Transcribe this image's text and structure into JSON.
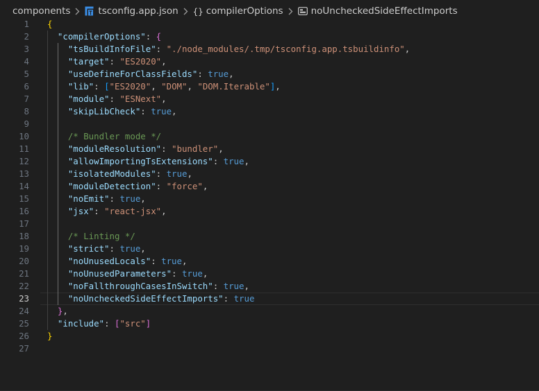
{
  "breadcrumb": {
    "folder": "components",
    "file": "tsconfig.app.json",
    "object_icon": "{}",
    "object": "compilerOptions",
    "property": "noUncheckedSideEffectImports"
  },
  "icons": {
    "file_icon": "typescript-config-file-icon",
    "object_icon": "json-object-icon",
    "property_icon": "json-property-icon",
    "separator_icon": "chevron-right-icon"
  },
  "colors": {
    "background": "#1f1f1f",
    "key": "#9cdcfe",
    "string": "#ce9178",
    "boolean": "#569cd6",
    "comment": "#6a9955",
    "bracket_level1": "#ffd700",
    "bracket_level2": "#da70d6",
    "bracket_level3": "#179fff"
  },
  "editor": {
    "current_line": 23,
    "lines": [
      {
        "n": "1",
        "t": [
          [
            "{",
            "b1"
          ]
        ]
      },
      {
        "n": "2",
        "t": [
          [
            "  "
          ],
          [
            "\"compilerOptions\"",
            "key"
          ],
          [
            ": ",
            "pun"
          ],
          [
            "{",
            "b2"
          ]
        ]
      },
      {
        "n": "3",
        "t": [
          [
            "    "
          ],
          [
            "\"tsBuildInfoFile\"",
            "key"
          ],
          [
            ": ",
            "pun"
          ],
          [
            "\"./node_modules/.tmp/tsconfig.app.tsbuildinfo\"",
            "str"
          ],
          [
            ",",
            "pun"
          ]
        ]
      },
      {
        "n": "4",
        "t": [
          [
            "    "
          ],
          [
            "\"target\"",
            "key"
          ],
          [
            ": ",
            "pun"
          ],
          [
            "\"ES2020\"",
            "str"
          ],
          [
            ",",
            "pun"
          ]
        ]
      },
      {
        "n": "5",
        "t": [
          [
            "    "
          ],
          [
            "\"useDefineForClassFields\"",
            "key"
          ],
          [
            ": ",
            "pun"
          ],
          [
            "true",
            "bool"
          ],
          [
            ",",
            "pun"
          ]
        ]
      },
      {
        "n": "6",
        "t": [
          [
            "    "
          ],
          [
            "\"lib\"",
            "key"
          ],
          [
            ": ",
            "pun"
          ],
          [
            "[",
            "b3"
          ],
          [
            "\"ES2020\"",
            "str"
          ],
          [
            ", ",
            "pun"
          ],
          [
            "\"DOM\"",
            "str"
          ],
          [
            ", ",
            "pun"
          ],
          [
            "\"DOM.Iterable\"",
            "str"
          ],
          [
            "]",
            "b3"
          ],
          [
            ",",
            "pun"
          ]
        ]
      },
      {
        "n": "7",
        "t": [
          [
            "    "
          ],
          [
            "\"module\"",
            "key"
          ],
          [
            ": ",
            "pun"
          ],
          [
            "\"ESNext\"",
            "str"
          ],
          [
            ",",
            "pun"
          ]
        ]
      },
      {
        "n": "8",
        "t": [
          [
            "    "
          ],
          [
            "\"skipLibCheck\"",
            "key"
          ],
          [
            ": ",
            "pun"
          ],
          [
            "true",
            "bool"
          ],
          [
            ",",
            "pun"
          ]
        ]
      },
      {
        "n": "9",
        "t": []
      },
      {
        "n": "10",
        "t": [
          [
            "    "
          ],
          [
            "/* Bundler mode */",
            "com"
          ]
        ]
      },
      {
        "n": "11",
        "t": [
          [
            "    "
          ],
          [
            "\"moduleResolution\"",
            "key"
          ],
          [
            ": ",
            "pun"
          ],
          [
            "\"bundler\"",
            "str"
          ],
          [
            ",",
            "pun"
          ]
        ]
      },
      {
        "n": "12",
        "t": [
          [
            "    "
          ],
          [
            "\"allowImportingTsExtensions\"",
            "key"
          ],
          [
            ": ",
            "pun"
          ],
          [
            "true",
            "bool"
          ],
          [
            ",",
            "pun"
          ]
        ]
      },
      {
        "n": "13",
        "t": [
          [
            "    "
          ],
          [
            "\"isolatedModules\"",
            "key"
          ],
          [
            ": ",
            "pun"
          ],
          [
            "true",
            "bool"
          ],
          [
            ",",
            "pun"
          ]
        ]
      },
      {
        "n": "14",
        "t": [
          [
            "    "
          ],
          [
            "\"moduleDetection\"",
            "key"
          ],
          [
            ": ",
            "pun"
          ],
          [
            "\"force\"",
            "str"
          ],
          [
            ",",
            "pun"
          ]
        ]
      },
      {
        "n": "15",
        "t": [
          [
            "    "
          ],
          [
            "\"noEmit\"",
            "key"
          ],
          [
            ": ",
            "pun"
          ],
          [
            "true",
            "bool"
          ],
          [
            ",",
            "pun"
          ]
        ]
      },
      {
        "n": "16",
        "t": [
          [
            "    "
          ],
          [
            "\"jsx\"",
            "key"
          ],
          [
            ": ",
            "pun"
          ],
          [
            "\"react-jsx\"",
            "str"
          ],
          [
            ",",
            "pun"
          ]
        ]
      },
      {
        "n": "17",
        "t": []
      },
      {
        "n": "18",
        "t": [
          [
            "    "
          ],
          [
            "/* Linting */",
            "com"
          ]
        ]
      },
      {
        "n": "19",
        "t": [
          [
            "    "
          ],
          [
            "\"strict\"",
            "key"
          ],
          [
            ": ",
            "pun"
          ],
          [
            "true",
            "bool"
          ],
          [
            ",",
            "pun"
          ]
        ]
      },
      {
        "n": "20",
        "t": [
          [
            "    "
          ],
          [
            "\"noUnusedLocals\"",
            "key"
          ],
          [
            ": ",
            "pun"
          ],
          [
            "true",
            "bool"
          ],
          [
            ",",
            "pun"
          ]
        ]
      },
      {
        "n": "21",
        "t": [
          [
            "    "
          ],
          [
            "\"noUnusedParameters\"",
            "key"
          ],
          [
            ": ",
            "pun"
          ],
          [
            "true",
            "bool"
          ],
          [
            ",",
            "pun"
          ]
        ]
      },
      {
        "n": "22",
        "t": [
          [
            "    "
          ],
          [
            "\"noFallthroughCasesInSwitch\"",
            "key"
          ],
          [
            ": ",
            "pun"
          ],
          [
            "true",
            "bool"
          ],
          [
            ",",
            "pun"
          ]
        ]
      },
      {
        "n": "23",
        "t": [
          [
            "    "
          ],
          [
            "\"noUncheckedSideEffectImports\"",
            "key"
          ],
          [
            ": ",
            "pun"
          ],
          [
            "true",
            "bool"
          ]
        ]
      },
      {
        "n": "24",
        "t": [
          [
            "  "
          ],
          [
            "}",
            "b2"
          ],
          [
            ",",
            "pun"
          ]
        ]
      },
      {
        "n": "25",
        "t": [
          [
            "  "
          ],
          [
            "\"include\"",
            "key"
          ],
          [
            ": ",
            "pun"
          ],
          [
            "[",
            "b2"
          ],
          [
            "\"src\"",
            "str"
          ],
          [
            "]",
            "b2"
          ]
        ]
      },
      {
        "n": "26",
        "t": [
          [
            "}",
            "b1"
          ]
        ]
      },
      {
        "n": "27",
        "t": []
      }
    ]
  }
}
